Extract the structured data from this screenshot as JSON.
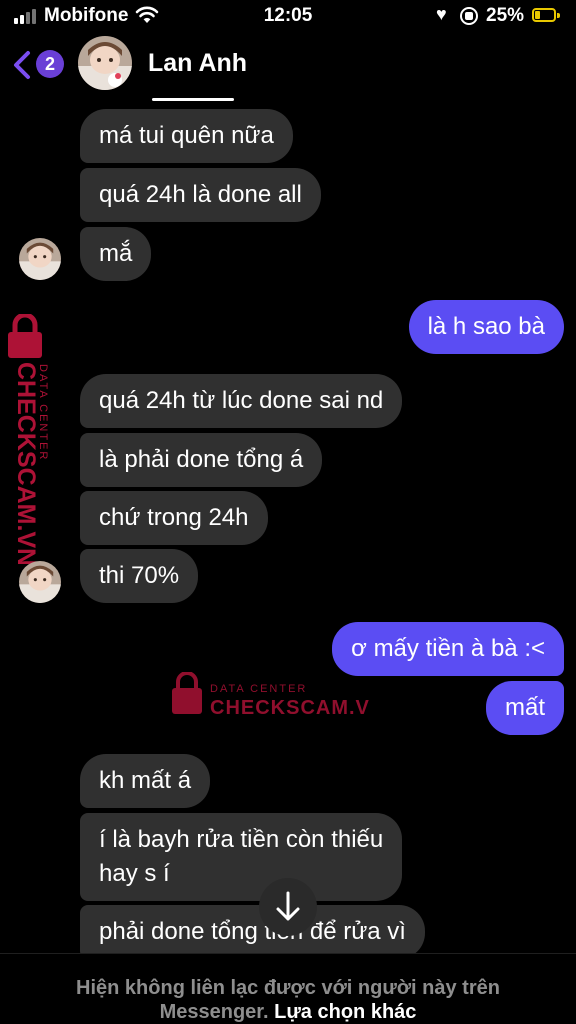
{
  "status_bar": {
    "carrier": "Mobifone",
    "time": "12:05",
    "battery_percent": "25%",
    "battery_level": 0.25,
    "battery_color": "#e8c800",
    "icons": [
      "signal-icon",
      "wifi-icon",
      "heart-icon",
      "rotation-lock-icon",
      "battery-charging-icon"
    ]
  },
  "header": {
    "unread_count": "2",
    "contact_name": "Lan Anh",
    "accent_color": "#7b4ef0"
  },
  "messages": [
    {
      "side": "in",
      "text": "má tui quên nữa"
    },
    {
      "side": "in",
      "text": "quá 24h là done all"
    },
    {
      "side": "in",
      "text": "mắ"
    },
    {
      "side": "out",
      "text": "là h sao bà"
    },
    {
      "side": "in",
      "text": "quá 24h từ lúc done sai nd"
    },
    {
      "side": "in",
      "text": "là phải done tổng á"
    },
    {
      "side": "in",
      "text": "chứ trong 24h"
    },
    {
      "side": "in",
      "text": "thi 70%"
    },
    {
      "side": "out",
      "text": "ơ mấy tiền à bà :<"
    },
    {
      "side": "out",
      "text": "mất"
    },
    {
      "side": "in",
      "text": "kh mất á"
    },
    {
      "side": "in",
      "text": "í là bayh rửa tiền còn thiếu\nhay s í"
    },
    {
      "side": "in",
      "text": "phải done tổng tiền để rửa vì"
    }
  ],
  "watermark": {
    "line1": "DATA CENTER",
    "line2": "CHECKSCAM.VN",
    "color": "#c0143c"
  },
  "footer": {
    "notice": "Hiện không liên lạc được với người này trên Messenger.",
    "link": "Lựa chọn khác"
  },
  "colors": {
    "incoming_bubble": "#303030",
    "outgoing_bubble": "#5b4df3",
    "background": "#000000"
  }
}
